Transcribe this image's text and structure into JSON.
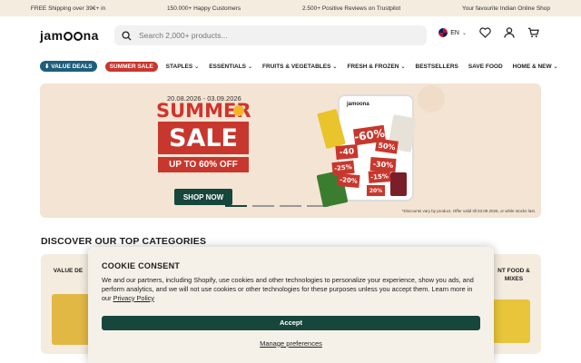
{
  "topbar": {
    "items": [
      "FREE Shipping over 39€+ in",
      "150.000+ Happy Customers",
      "2.500+ Positive Reviews on Trustpilot",
      "Your favourite Indian Online Shop"
    ]
  },
  "header": {
    "logo_prefix": "jam",
    "logo_suffix": "na",
    "search_placeholder": "Search 2,000+ products...",
    "lang": "EN"
  },
  "nav": {
    "value_deals": "⬇ VALUE DEALS",
    "summer_sale": "SUMMER SALE",
    "items": [
      "STAPLES",
      "ESSENTIALS",
      "FRUITS & VEGETABLES",
      "FRESH & FROZEN",
      "BESTSELLERS",
      "SAVE FOOD",
      "HOME & NEW"
    ]
  },
  "hero": {
    "dates": "20.08.2026 - 03.09.2026",
    "summer": "SUMMER",
    "sale": "SALE",
    "upto": "UP TO 60% OFF",
    "cta": "SHOP NOW",
    "phone_brand": "jamoona",
    "discounts": [
      "-60%",
      "50%",
      "-40",
      "-30%",
      "-25%",
      "-20%",
      "-15%",
      "20%"
    ],
    "note": "*Discounts vary by product. Offer valid till 03.09.2026, or while stocks last."
  },
  "categories": {
    "title": "DISCOVER OUR TOP CATEGORIES",
    "left_label": "VALUE DE",
    "right_label_1": "NT FOOD &",
    "right_label_2": "MIXES"
  },
  "cookie": {
    "title": "COOKIE CONSENT",
    "body": "We and our partners, including Shopify, use cookies and other technologies to personalize your experience, show you ads, and perform analytics, and we will not use cookies or other technologies for these purposes unless you accept them. Learn more in our ",
    "privacy_link": "Privacy Policy",
    "accept": "Accept",
    "manage": "Manage preferences"
  }
}
